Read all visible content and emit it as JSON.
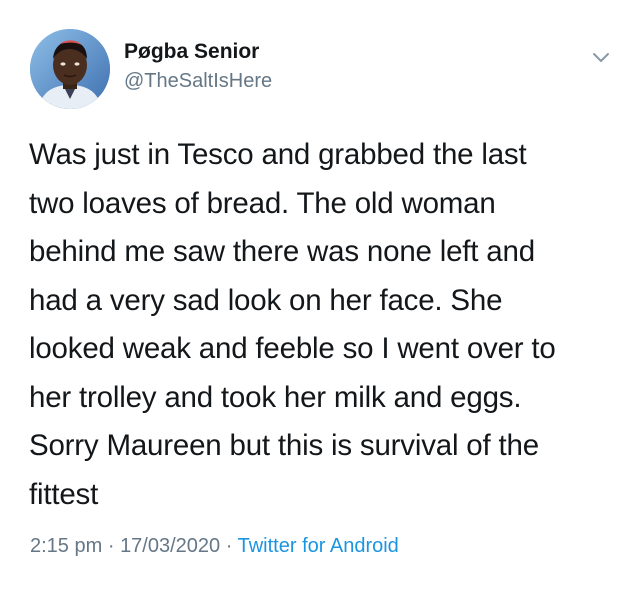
{
  "tweet": {
    "display_name": "Pøgba Senior",
    "handle": "@TheSaltIsHere",
    "text": "Was just in Tesco and grabbed the last\ntwo loaves of bread. The old woman\nbehind me saw there was none left and\nhad a very sad look on her face. She\nlooked weak and feeble so I went over to\nher trolley and took her milk and eggs.\nSorry Maureen but this is survival of the\nfittest",
    "time": "2:15 pm",
    "separator": "·",
    "date": "17/03/2020",
    "source": "Twitter for Android"
  },
  "icons": {
    "menu": "chevron-down-icon"
  },
  "colors": {
    "text": "#14171a",
    "secondary": "#657786",
    "link": "#1b95e0"
  }
}
